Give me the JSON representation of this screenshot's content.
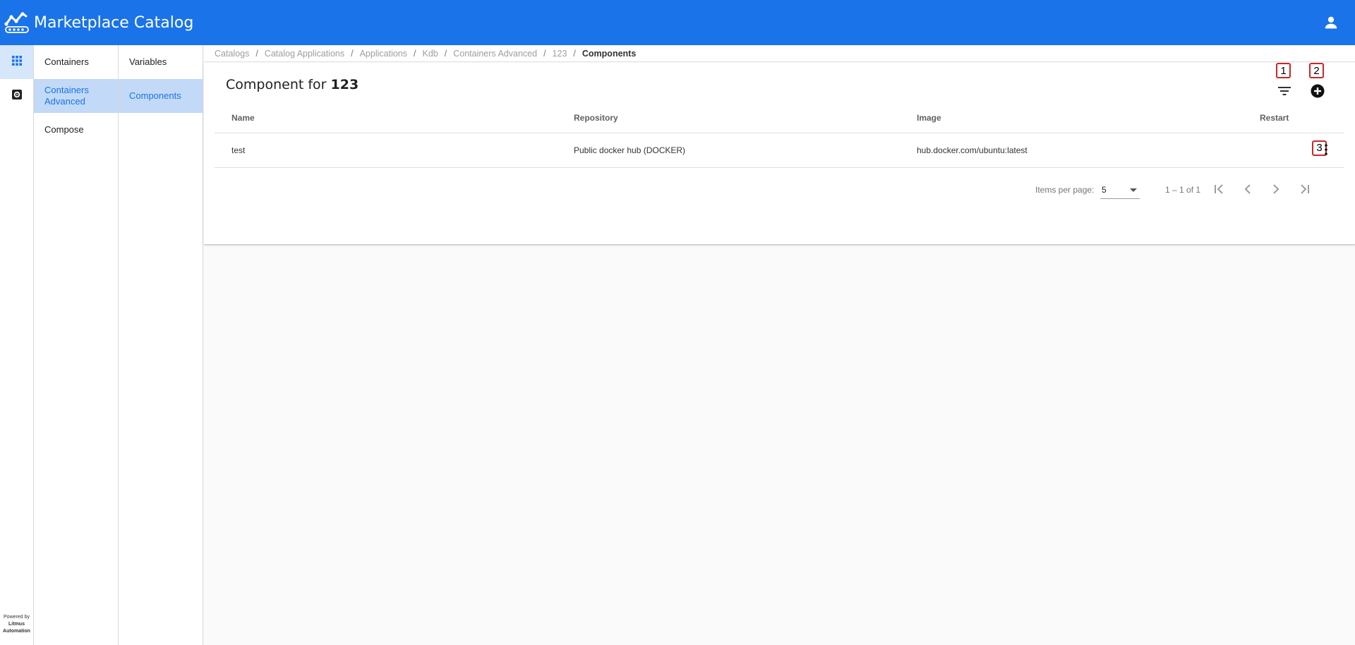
{
  "app": {
    "title": "Marketplace Catalog"
  },
  "icons": {
    "logo": "chart-line-logo",
    "user": "account-icon",
    "apps": "grid-apps-icon",
    "settings": "gear-box-icon",
    "filter": "filter-list-icon",
    "add": "add-circle-icon",
    "more": "more-vertical-icon",
    "first": "first-page-icon",
    "prev": "chevron-left-icon",
    "next": "chevron-right-icon",
    "last": "last-page-icon"
  },
  "colors": {
    "brand": "#1a73e8",
    "active_nav": "#c2d9f7",
    "annotation": "#c62828"
  },
  "rail": {
    "powered_by": "Powered by",
    "company_line1": "Litmus",
    "company_line2": "Automation"
  },
  "nav1": {
    "items": [
      {
        "label": "Containers",
        "active": false
      },
      {
        "label": "Containers Advanced",
        "active": true
      },
      {
        "label": "Compose",
        "active": false
      }
    ]
  },
  "nav2": {
    "items": [
      {
        "label": "Variables",
        "active": false
      },
      {
        "label": "Components",
        "active": true
      }
    ]
  },
  "breadcrumb": {
    "items": [
      "Catalogs",
      "Catalog Applications",
      "Applications",
      "Kdb",
      "Containers Advanced",
      "123"
    ],
    "separator": "/",
    "current": "Components"
  },
  "card": {
    "title_prefix": "Component for",
    "title_value": "123"
  },
  "annotations": [
    "1",
    "2",
    "3"
  ],
  "table": {
    "columns": [
      "Name",
      "Repository",
      "Image",
      "Restart"
    ],
    "rows": [
      {
        "name": "test",
        "repository": "Public docker hub (DOCKER)",
        "image": "hub.docker.com/ubuntu:latest",
        "restart": ""
      }
    ]
  },
  "paginator": {
    "items_per_page_label": "Items per page:",
    "items_per_page": "5",
    "range": "1 – 1 of 1"
  }
}
